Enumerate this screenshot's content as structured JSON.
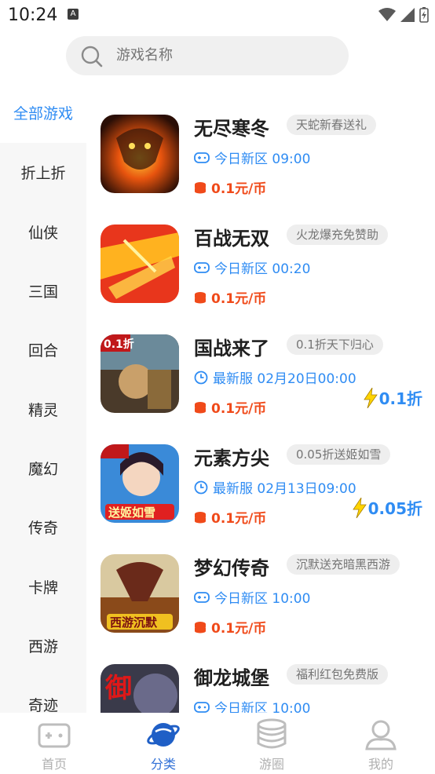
{
  "status": {
    "time": "10:24",
    "a_badge": "A"
  },
  "search": {
    "placeholder": "游戏名称"
  },
  "sidebar": {
    "items": [
      "全部游戏",
      "折上折",
      "仙侠",
      "三国",
      "回合",
      "精灵",
      "魔幻",
      "传奇",
      "卡牌",
      "西游",
      "奇迹"
    ],
    "active_index": 0
  },
  "games": [
    {
      "name": "无尽寒冬",
      "tag": "天蛇新春送礼",
      "info_type": "gamepad",
      "info": "今日新区 09:00",
      "price": "0.1元/币",
      "discount": "",
      "thumb_label": ""
    },
    {
      "name": "百战无双",
      "tag": "火龙爆充免赞助",
      "info_type": "gamepad",
      "info": "今日新区 00:20",
      "price": "0.1元/币",
      "discount": "",
      "thumb_label": ""
    },
    {
      "name": "国战来了",
      "tag": "0.1折天下归心",
      "info_type": "clock",
      "info": "最新服 02月20日00:00",
      "price": "0.1元/币",
      "discount": "0.1折",
      "thumb_label": "0.1折"
    },
    {
      "name": "元素方尖",
      "tag": "0.05折送姬如雪",
      "info_type": "clock",
      "info": "最新服 02月13日09:00",
      "price": "0.1元/币",
      "discount": "0.05折",
      "thumb_label": "送姬如雪"
    },
    {
      "name": "梦幻传奇",
      "tag": "沉默送充暗黑西游",
      "info_type": "gamepad",
      "info": "今日新区 10:00",
      "price": "0.1元/币",
      "discount": "",
      "thumb_label": "西游沉默"
    },
    {
      "name": "御龙城堡",
      "tag": "福利红包免费版",
      "info_type": "gamepad",
      "info": "今日新区 10:00",
      "price": "",
      "discount": "",
      "thumb_label": "御"
    }
  ],
  "nav": [
    {
      "label": "首页",
      "icon": "gamepad-icon"
    },
    {
      "label": "分类",
      "icon": "planet-icon"
    },
    {
      "label": "游圈",
      "icon": "stack-icon"
    },
    {
      "label": "我的",
      "icon": "user-icon"
    }
  ],
  "colors": {
    "accent": "#2f8cf3",
    "price": "#f04a1a",
    "nav_active": "#2f6fd6"
  }
}
